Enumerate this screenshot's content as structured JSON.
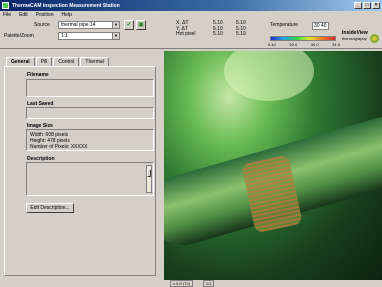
{
  "window": {
    "title": "ThermaCAM Inspection Measurement Station",
    "minimize": "_",
    "maximize": "□",
    "close": "×"
  },
  "menu": [
    "File",
    "Edit",
    "Position",
    "Help"
  ],
  "toolbar": {
    "source_label": "Source",
    "source_value": "thermal pipe 14",
    "palette_label": "Palette/Zoom",
    "palette_value": "1:1",
    "readout_labels": [
      "X, ΔT",
      "Y, ΔT",
      "Hot pixel"
    ],
    "readout_col1": [
      "5.10",
      "5.10",
      "5.10"
    ],
    "readout_col2": [
      "5.10",
      "5.10",
      "5.10"
    ],
    "readout_col3": [
      "5.10",
      "5.10",
      "5.10"
    ],
    "temp_label": "Temperature",
    "temp_value": "30 40",
    "scale_labels": [
      "5.10",
      "20.0",
      "30.0",
      "31.0"
    ],
    "brand": "InsideView",
    "brand_sub": "thermography"
  },
  "tabs": [
    "General",
    "Pill",
    "Control",
    "Thermal"
  ],
  "fields": {
    "filename_label": "Filename",
    "last_saved_label": "Last Saved",
    "image_size_label": "Image Size",
    "image_size_lines": [
      "Width: 608 pixels",
      "Height: 478 pixels",
      "Number of Pixels: XXXXX"
    ],
    "description_label": "Description",
    "edit_button": "Edit Description..."
  },
  "status": {
    "coords": "x 0.0 (72)",
    "zoom": "1/1"
  },
  "icons": {
    "green_check": "check-icon",
    "camera": "camera-icon"
  }
}
